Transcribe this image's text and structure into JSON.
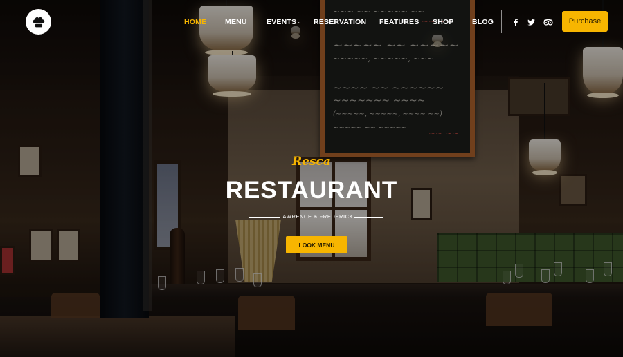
{
  "header": {
    "logo_icon": "chef-hat-icon",
    "nav": [
      {
        "label": "HOME",
        "active": true
      },
      {
        "label": "MENU"
      },
      {
        "label": "EVENTS",
        "has_dropdown": true
      },
      {
        "label": "RESERVATION"
      },
      {
        "label": "FEATURES",
        "has_dropdown": true
      },
      {
        "label": "SHOP"
      },
      {
        "label": "BLOG"
      }
    ],
    "social": [
      "facebook-icon",
      "twitter-icon",
      "tripadvisor-icon"
    ],
    "purchase_label": "Purchase"
  },
  "hero": {
    "script_text": "Resca",
    "title": "RESTAURANT",
    "subtitle": "LAWRENCE & FREDERICK",
    "button_label": "LOOK MENU"
  },
  "colors": {
    "accent": "#f7b500",
    "text": "#ffffff"
  }
}
